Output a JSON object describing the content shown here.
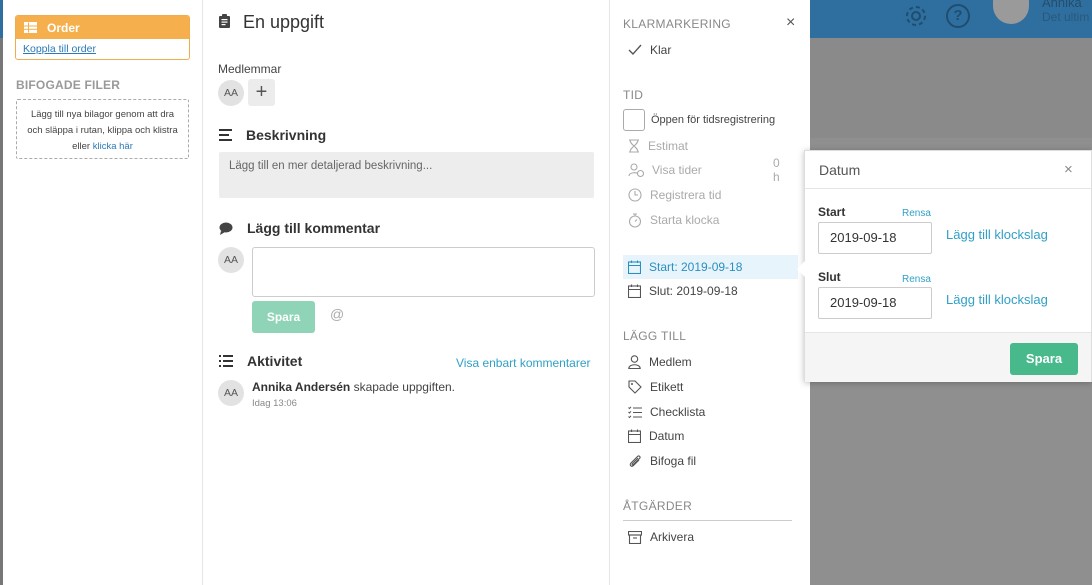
{
  "background": {
    "user_name": "Annika",
    "user_sub": "Det ultim",
    "help_glyph": "?"
  },
  "left": {
    "order_title": "Order",
    "order_link": "Koppla till order",
    "files_title": "BIFOGADE FILER",
    "dropzone_text": "Lägg till nya bilagor genom att dra och släppa i rutan, klippa och klistra eller",
    "dropzone_link": "klicka här"
  },
  "main": {
    "title": "En uppgift",
    "members_label": "Medlemmar",
    "member_initials": "AA",
    "add_member_glyph": "+",
    "description_title": "Beskrivning",
    "description_placeholder": "Lägg till en mer detaljerad beskrivning...",
    "comment_title": "Lägg till kommentar",
    "comment_value": "",
    "save_label": "Spara",
    "mention_glyph": "@",
    "activity_title": "Aktivitet",
    "activity_filter": "Visa enbart kommentarer",
    "activity": {
      "initials": "AA",
      "user": "Annika Andersén",
      "action": " skapade uppgiften.",
      "time": "Idag 13:06"
    }
  },
  "side": {
    "close_glyph": "×",
    "done_header": "KLARMARKERING",
    "done_label": "Klar",
    "time_header": "TID",
    "time_tracking_label": "Öppen för tidsregistrering",
    "estimate_label": "Estimat",
    "show_times_label": "Visa tider",
    "show_times_value": "0 h",
    "register_time_label": "Registrera tid",
    "start_clock_label": "Starta klocka",
    "start_label": "Start: 2019-09-18",
    "end_label": "Slut: 2019-09-18",
    "add_header": "LÄGG TILL",
    "add_items": [
      "Medlem",
      "Etikett",
      "Checklista",
      "Datum",
      "Bifoga fil"
    ],
    "actions_header": "ÅTGÄRDER",
    "archive_label": "Arkivera"
  },
  "popover": {
    "title": "Datum",
    "close_glyph": "×",
    "start_label": "Start",
    "start_clear": "Rensa",
    "start_value": "2019-09-18",
    "start_time_link": "Lägg till klockslag",
    "end_label": "Slut",
    "end_clear": "Rensa",
    "end_value": "2019-09-18",
    "end_time_link": "Lägg till klockslag",
    "save_label": "Spara"
  },
  "colors": {
    "accent_blue": "#2fa0c6",
    "order_orange": "#f5b04d",
    "save_green": "#47b98b",
    "save_green_disabled": "#8fd4b7"
  }
}
